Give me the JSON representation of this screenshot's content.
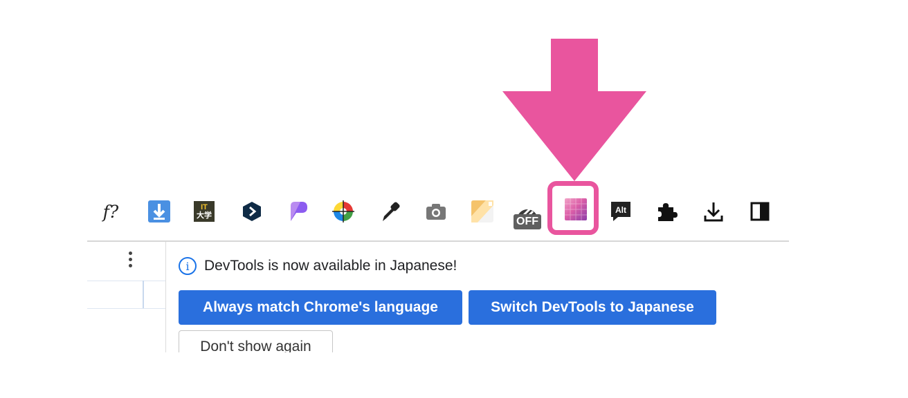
{
  "toolbar": {
    "extensions": [
      {
        "icon": "function-query-icon",
        "label": "f?"
      },
      {
        "icon": "download-arrow-icon"
      },
      {
        "icon": "it-daigaku-icon",
        "label_top": "IT",
        "label_bottom": "大学"
      },
      {
        "icon": "deepl-icon"
      },
      {
        "icon": "pdf-shape-icon"
      },
      {
        "icon": "color-wheel-icon"
      },
      {
        "icon": "eyedropper-icon"
      },
      {
        "icon": "camera-icon"
      },
      {
        "icon": "memo-icon"
      },
      {
        "icon": "speedometer-icon",
        "badge": "OFF"
      },
      {
        "icon": "gradient-square-icon",
        "highlighted": true
      },
      {
        "icon": "alt-text-icon",
        "label": "Alt"
      },
      {
        "icon": "puzzle-extensions-icon"
      },
      {
        "icon": "downloads-icon"
      },
      {
        "icon": "side-panel-icon"
      }
    ],
    "highlight_color": "#e9559e"
  },
  "devtools": {
    "notice": "DevTools is now available in Japanese!",
    "buttons": {
      "match_language": "Always match Chrome's language",
      "switch_language": "Switch DevTools to Japanese",
      "dont_show": "Don't show again"
    },
    "accent_color": "#2a6fdd"
  }
}
